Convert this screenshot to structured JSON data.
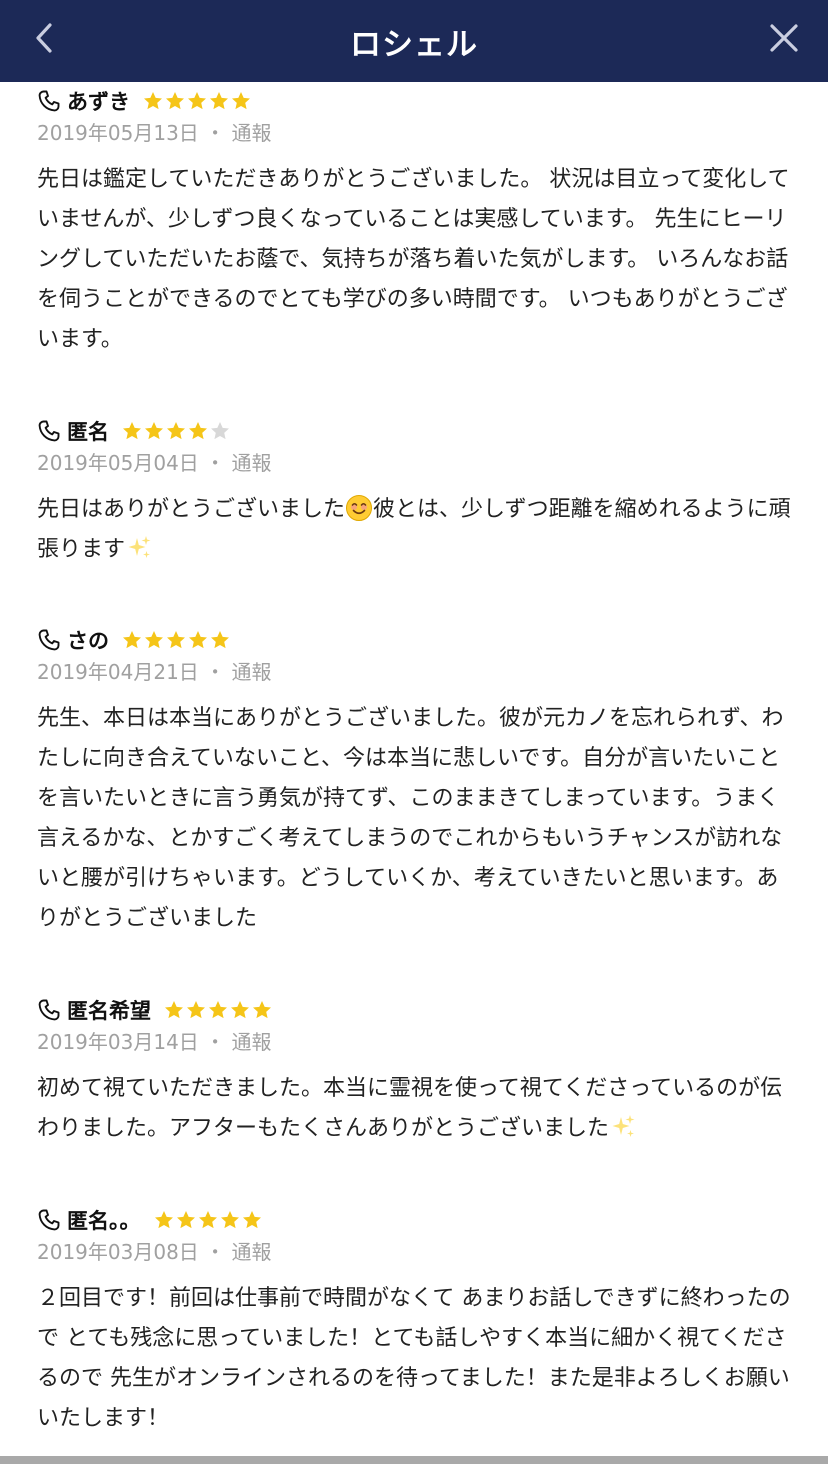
{
  "header": {
    "title": "ロシェル",
    "back_icon": "chevron-left-icon",
    "close_icon": "close-icon",
    "background": "#1c2957"
  },
  "colors": {
    "star_filled": "#f5c518",
    "star_empty": "#d8d8d8",
    "meta_text": "#a0a0a0"
  },
  "reviews": [
    {
      "name": "あずき",
      "rating": 5,
      "date": "2019年05月13日",
      "separator": "・",
      "report_label": "通報",
      "text": "先日は鑑定していただきありがとうございました。 状況は目立って変化していませんが、少しずつ良くなっていることは実感しています。 先生にヒーリングしていただいたお蔭で、気持ちが落ち着いた気がします。 いろんなお話を伺うことができるのでとても学びの多い時間です。 いつもありがとうございます。"
    },
    {
      "name": "匿名",
      "rating": 4,
      "date": "2019年05月04日",
      "separator": "・",
      "report_label": "通報",
      "text_part1": "先日はありがとうございました",
      "text_part2": "彼とは、少しずつ距離を縮めれるように頑張ります"
    },
    {
      "name": "さの",
      "rating": 5,
      "date": "2019年04月21日",
      "separator": "・",
      "report_label": "通報",
      "text": "先生、本日は本当にありがとうございました。彼が元カノを忘れられず、わたしに向き合えていないこと、今は本当に悲しいです。自分が言いたいことを言いたいときに言う勇気が持てず、このままきてしまっています。うまく言えるかな、とかすごく考えてしまうのでこれからもいうチャンスが訪れないと腰が引けちゃいます。どうしていくか、考えていきたいと思います。ありがとうございました"
    },
    {
      "name": "匿名希望",
      "rating": 5,
      "date": "2019年03月14日",
      "separator": "・",
      "report_label": "通報",
      "text": "初めて視ていただきました。本当に霊視を使って視てくださっているのが伝わりました。アフターもたくさんありがとうございました"
    },
    {
      "name": "匿名。。",
      "rating": 5,
      "date": "2019年03月08日",
      "separator": "・",
      "report_label": "通報",
      "text": "２回目です！前回は仕事前で時間がなくて あまりお話しできずに終わったので とても残念に思っていました！とても話しやすく本当に細かく視てくださるので 先生がオンラインされるのを待ってました！また是非よろしくお願いいたします！"
    }
  ]
}
